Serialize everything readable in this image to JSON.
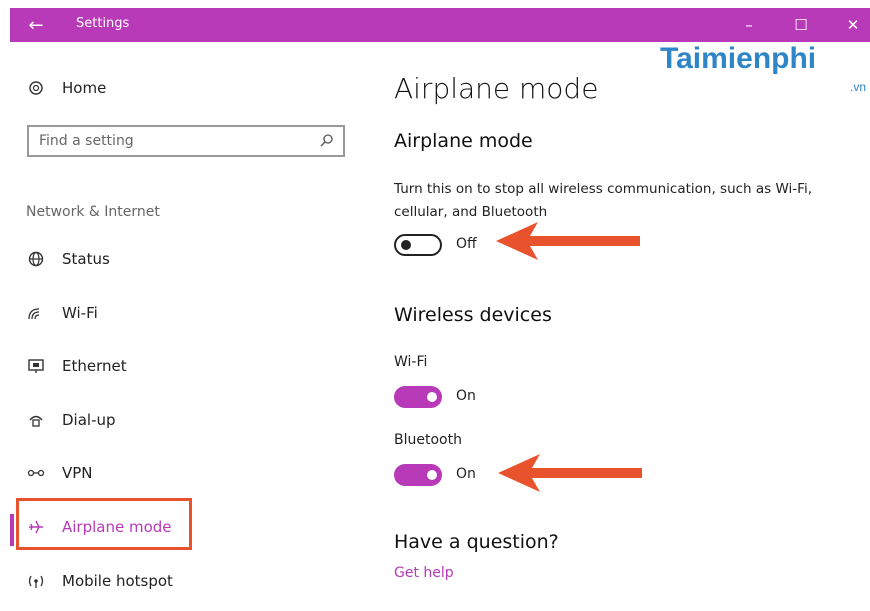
{
  "window": {
    "title": "Settings",
    "back_icon": "arrow-left-icon",
    "minimize": "–",
    "maximize": "☐",
    "close": "✕"
  },
  "watermark": {
    "text": "Taimienphi",
    "suffix": ".vn"
  },
  "sidebar": {
    "home_label": "Home",
    "search_placeholder": "Find a setting",
    "section_label": "Network & Internet",
    "items": [
      {
        "label": "Status",
        "icon": "globe-icon"
      },
      {
        "label": "Wi-Fi",
        "icon": "wifi-icon"
      },
      {
        "label": "Ethernet",
        "icon": "ethernet-icon"
      },
      {
        "label": "Dial-up",
        "icon": "dialup-icon"
      },
      {
        "label": "VPN",
        "icon": "vpn-icon"
      },
      {
        "label": "Airplane mode",
        "icon": "airplane-icon",
        "active": true
      },
      {
        "label": "Mobile hotspot",
        "icon": "hotspot-icon"
      }
    ]
  },
  "main": {
    "title": "Airplane mode",
    "airplane": {
      "heading": "Airplane mode",
      "description": "Turn this on to stop all wireless communication, such as Wi-Fi, cellular, and Bluetooth",
      "state": "Off"
    },
    "wireless": {
      "heading": "Wireless devices",
      "wifi_label": "Wi-Fi",
      "wifi_state": "On",
      "bluetooth_label": "Bluetooth",
      "bluetooth_state": "On"
    },
    "question": {
      "heading": "Have a question?",
      "link": "Get help"
    }
  },
  "colors": {
    "accent": "#b83ab8",
    "annotation": "#e8532e",
    "watermark": "#2e86c9"
  }
}
